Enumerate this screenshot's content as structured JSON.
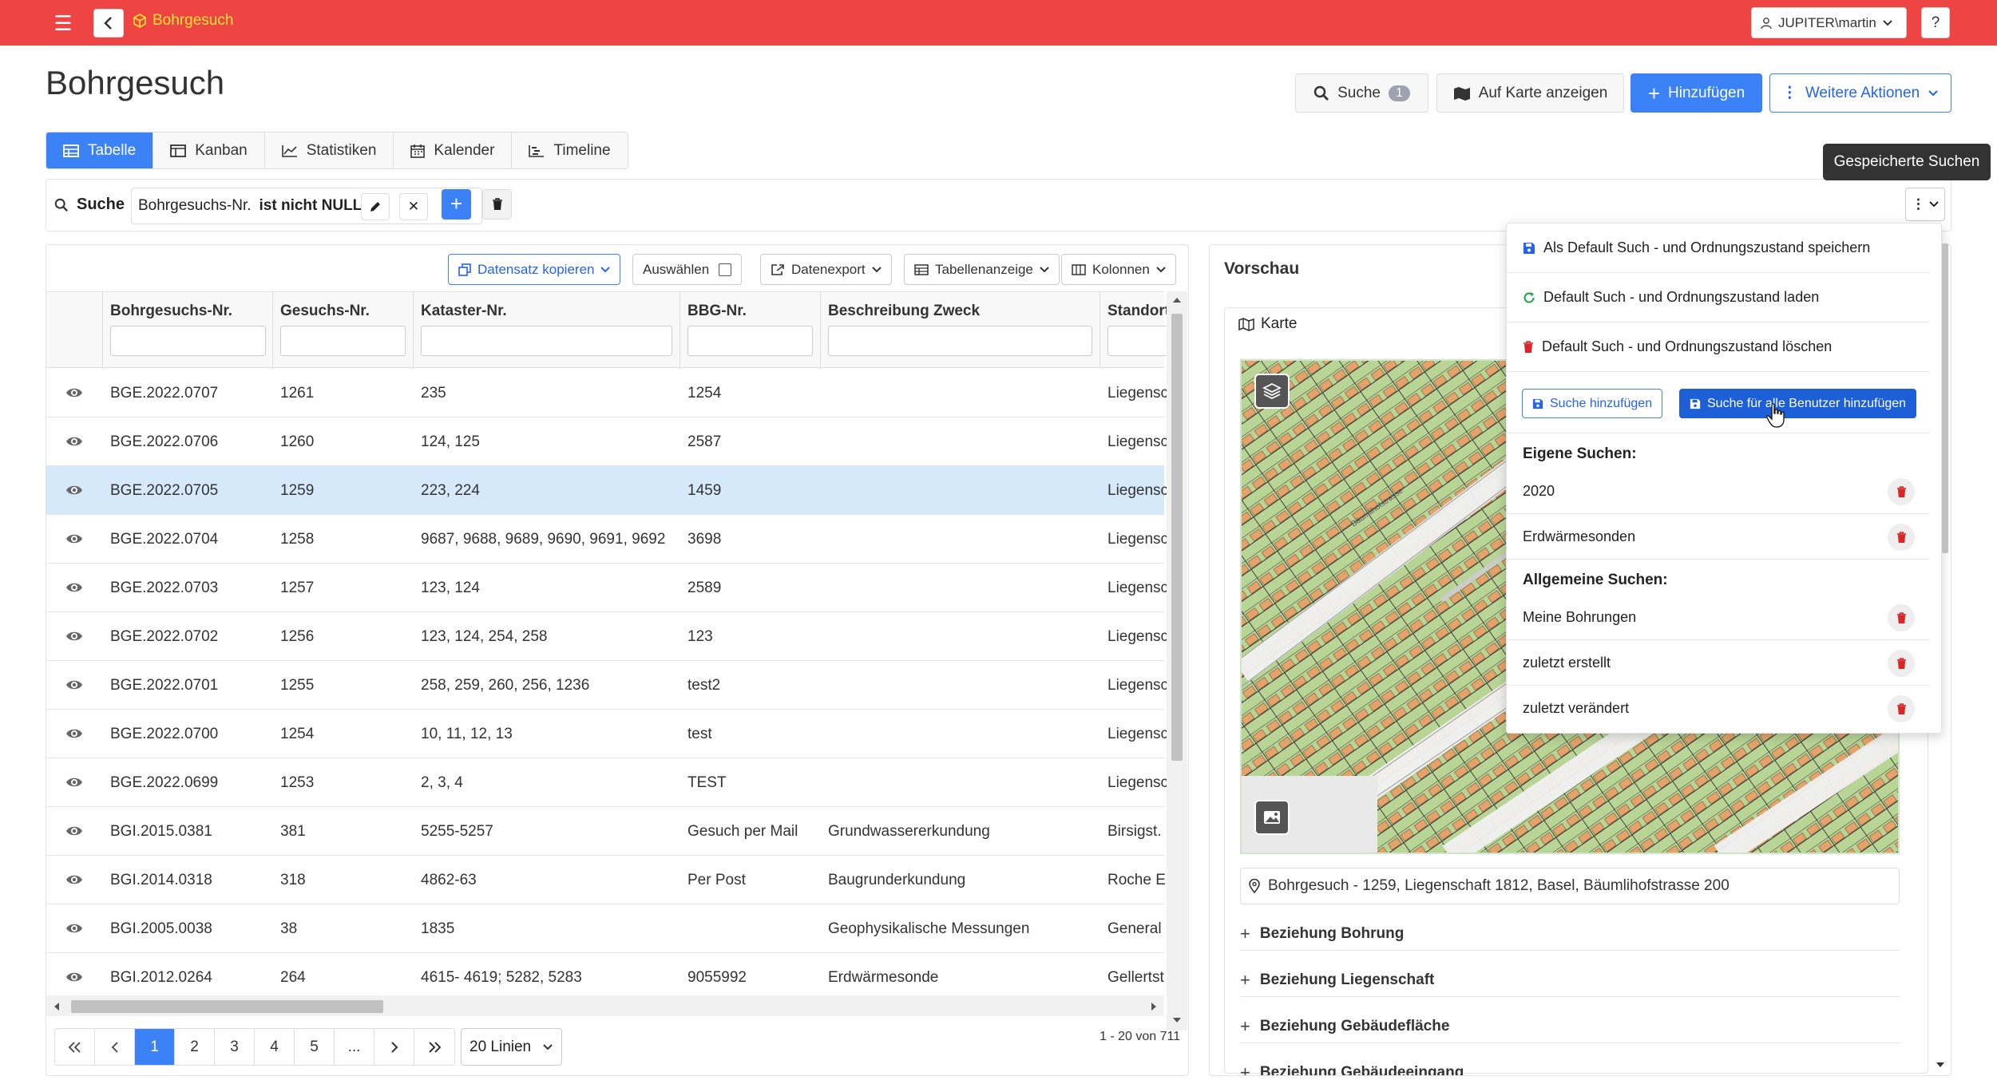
{
  "app": {
    "title": "Bohrgesuch",
    "user": "JUPITER\\martin",
    "help": "?"
  },
  "page": {
    "title": "Bohrgesuch"
  },
  "header_buttons": {
    "search": "Suche",
    "search_count": "1",
    "map": "Auf Karte anzeigen",
    "add": "Hinzufügen",
    "more": "Weitere Aktionen"
  },
  "tabs": [
    {
      "label": "Tabelle",
      "icon": "table-icon",
      "active": true
    },
    {
      "label": "Kanban",
      "icon": "kanban-icon",
      "active": false
    },
    {
      "label": "Statistiken",
      "icon": "chart-line-icon",
      "active": false
    },
    {
      "label": "Kalender",
      "icon": "calendar-icon",
      "active": false
    },
    {
      "label": "Timeline",
      "icon": "timeline-icon",
      "active": false
    }
  ],
  "search": {
    "label": "Suche",
    "filter_field": "Bohrgesuchs-Nr.",
    "filter_op": "ist nicht NULL"
  },
  "tooltip": "Gespeicherte Suchen",
  "toolbar": {
    "copy": "Datensatz kopieren",
    "select": "Auswählen",
    "export": "Datenexport",
    "view": "Tabellenanzeige",
    "columns": "Kolonnen"
  },
  "table": {
    "columns": [
      "Bohrgesuchs-Nr.",
      "Gesuchs-Nr.",
      "Kataster-Nr.",
      "BBG-Nr.",
      "Beschreibung Zweck",
      "Standort"
    ],
    "rows": [
      [
        "BGE.2022.0707",
        "1261",
        "235",
        "1254",
        "",
        "Liegensc"
      ],
      [
        "BGE.2022.0706",
        "1260",
        "124, 125",
        "2587",
        "",
        "Liegensc"
      ],
      [
        "BGE.2022.0705",
        "1259",
        "223, 224",
        "1459",
        "",
        "Liegensc"
      ],
      [
        "BGE.2022.0704",
        "1258",
        "9687, 9688, 9689, 9690, 9691, 9692",
        "3698",
        "",
        "Liegensc"
      ],
      [
        "BGE.2022.0703",
        "1257",
        "123, 124",
        "2589",
        "",
        "Liegensc"
      ],
      [
        "BGE.2022.0702",
        "1256",
        "123, 124, 254, 258",
        "123",
        "",
        "Liegensc"
      ],
      [
        "BGE.2022.0701",
        "1255",
        "258, 259, 260, 256, 1236",
        "test2",
        "",
        "Liegensc"
      ],
      [
        "BGE.2022.0700",
        "1254",
        "10, 11, 12, 13",
        "test",
        "",
        "Liegensc"
      ],
      [
        "BGE.2022.0699",
        "1253",
        "2, 3, 4",
        "TEST",
        "",
        "Liegensc"
      ],
      [
        "BGI.2015.0381",
        "381",
        "5255-5257",
        "Gesuch per Mail",
        "Grundwassererkundung",
        "Birsigst."
      ],
      [
        "BGI.2014.0318",
        "318",
        "4862-63",
        "Per Post",
        "Baugrunderkundung",
        "Roche Er"
      ],
      [
        "BGI.2005.0038",
        "38",
        "1835",
        "",
        "Geophysikalische Messungen",
        "General ("
      ],
      [
        "BGI.2012.0264",
        "264",
        "4615- 4619; 5282, 5283",
        "9055992",
        "Erdwärmesonde",
        "Gellertst"
      ]
    ],
    "selected_row": 2
  },
  "pagination": {
    "pages": [
      "1",
      "2",
      "3",
      "4",
      "5",
      "..."
    ],
    "active": "1",
    "lines": "20 Linien",
    "count": "1 - 20 von 711"
  },
  "preview": {
    "title": "Vorschau",
    "map_label": "Karte",
    "address": "Bohrgesuch - 1259, Liegenschaft 1812, Basel, Bäumlihofstrasse 200",
    "relations": [
      "Beziehung Bohrung",
      "Beziehung Liegenschaft",
      "Beziehung Gebäudefläche",
      "Beziehung Gebäudeeingang"
    ]
  },
  "dropdown": {
    "items": [
      "Als Default Such - und Ordnungszustand speichern",
      "Default Such - und Ordnungszustand laden",
      "Default Such - und Ordnungszustand löschen"
    ],
    "add_search": "Suche hinzufügen",
    "add_search_all": "Suche für alle Benutzer hinzufügen",
    "own_heading": "Eigene Suchen:",
    "own": [
      "2020",
      "Erdwärmesonden"
    ],
    "general_heading": "Allgemeine Suchen:",
    "general": [
      "Meine Bohrungen",
      "zuletzt erstellt",
      "zuletzt verändert"
    ]
  },
  "colors": {
    "brand": "#ef4444",
    "title_accent": "#ffe533",
    "primary": "#3b82f6",
    "danger": "#dc2626",
    "selected_row": "#d6e9fb"
  }
}
